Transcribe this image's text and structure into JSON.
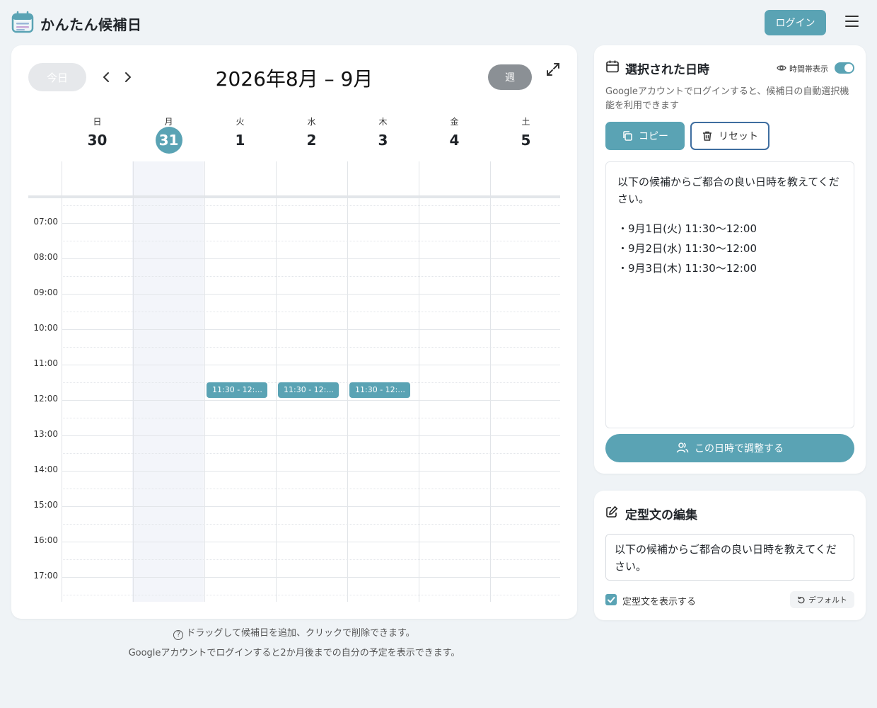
{
  "header": {
    "app_title": "かんたん候補日",
    "login_label": "ログイン"
  },
  "calendar": {
    "today_label": "今日",
    "title": "2026年8月 – 9月",
    "view_label": "週",
    "days": [
      {
        "name": "日",
        "num": "30"
      },
      {
        "name": "月",
        "num": "31",
        "today": true
      },
      {
        "name": "火",
        "num": "1"
      },
      {
        "name": "水",
        "num": "2"
      },
      {
        "name": "木",
        "num": "3"
      },
      {
        "name": "金",
        "num": "4"
      },
      {
        "name": "土",
        "num": "5"
      }
    ],
    "time_labels": [
      "07:00",
      "08:00",
      "09:00",
      "10:00",
      "11:00",
      "12:00",
      "13:00",
      "14:00",
      "15:00",
      "16:00",
      "17:00"
    ],
    "events": [
      {
        "day_index": 2,
        "label": "11:30 - 12:..."
      },
      {
        "day_index": 3,
        "label": "11:30 - 12:..."
      },
      {
        "day_index": 4,
        "label": "11:30 - 12:..."
      }
    ],
    "hint_drag": "ドラッグして候補日を追加、クリックで削除できます。",
    "hint_login": "Googleアカウントでログインすると2か月後までの自分の予定を表示できます。"
  },
  "selected": {
    "title": "選択された日時",
    "timezone_label": "時間帯表示",
    "description": "Googleアカウントでログインすると、候補日の自動選択機能を利用できます",
    "copy_label": "コピー",
    "reset_label": "リセット",
    "result_header": "以下の候補からご都合の良い日時を教えてください。",
    "result_items": [
      "・9月1日(火) 11:30〜12:00",
      "・9月2日(水) 11:30〜12:00",
      "・9月3日(木) 11:30〜12:00"
    ],
    "adjust_label": "この日時で調整する"
  },
  "template": {
    "title": "定型文の編集",
    "text": "以下の候補からご都合の良い日時を教えてください。",
    "show_label": "定型文を表示する",
    "default_label": "デフォルト"
  },
  "colors": {
    "accent": "#5aa3b4",
    "reset_border": "#3f6ea0",
    "background": "#eff3f6"
  },
  "icons": {
    "logo": "calendar-icon",
    "menu": "hamburger-menu-icon",
    "prev": "chevron-left-icon",
    "next": "chevron-right-icon",
    "expand": "expand-icon",
    "copy": "copy-icon",
    "reset": "trash-icon",
    "eye": "eye-icon",
    "adjust": "users-icon",
    "edit": "edit-icon",
    "default": "rotate-ccw-icon",
    "help": "help-circle-icon"
  }
}
